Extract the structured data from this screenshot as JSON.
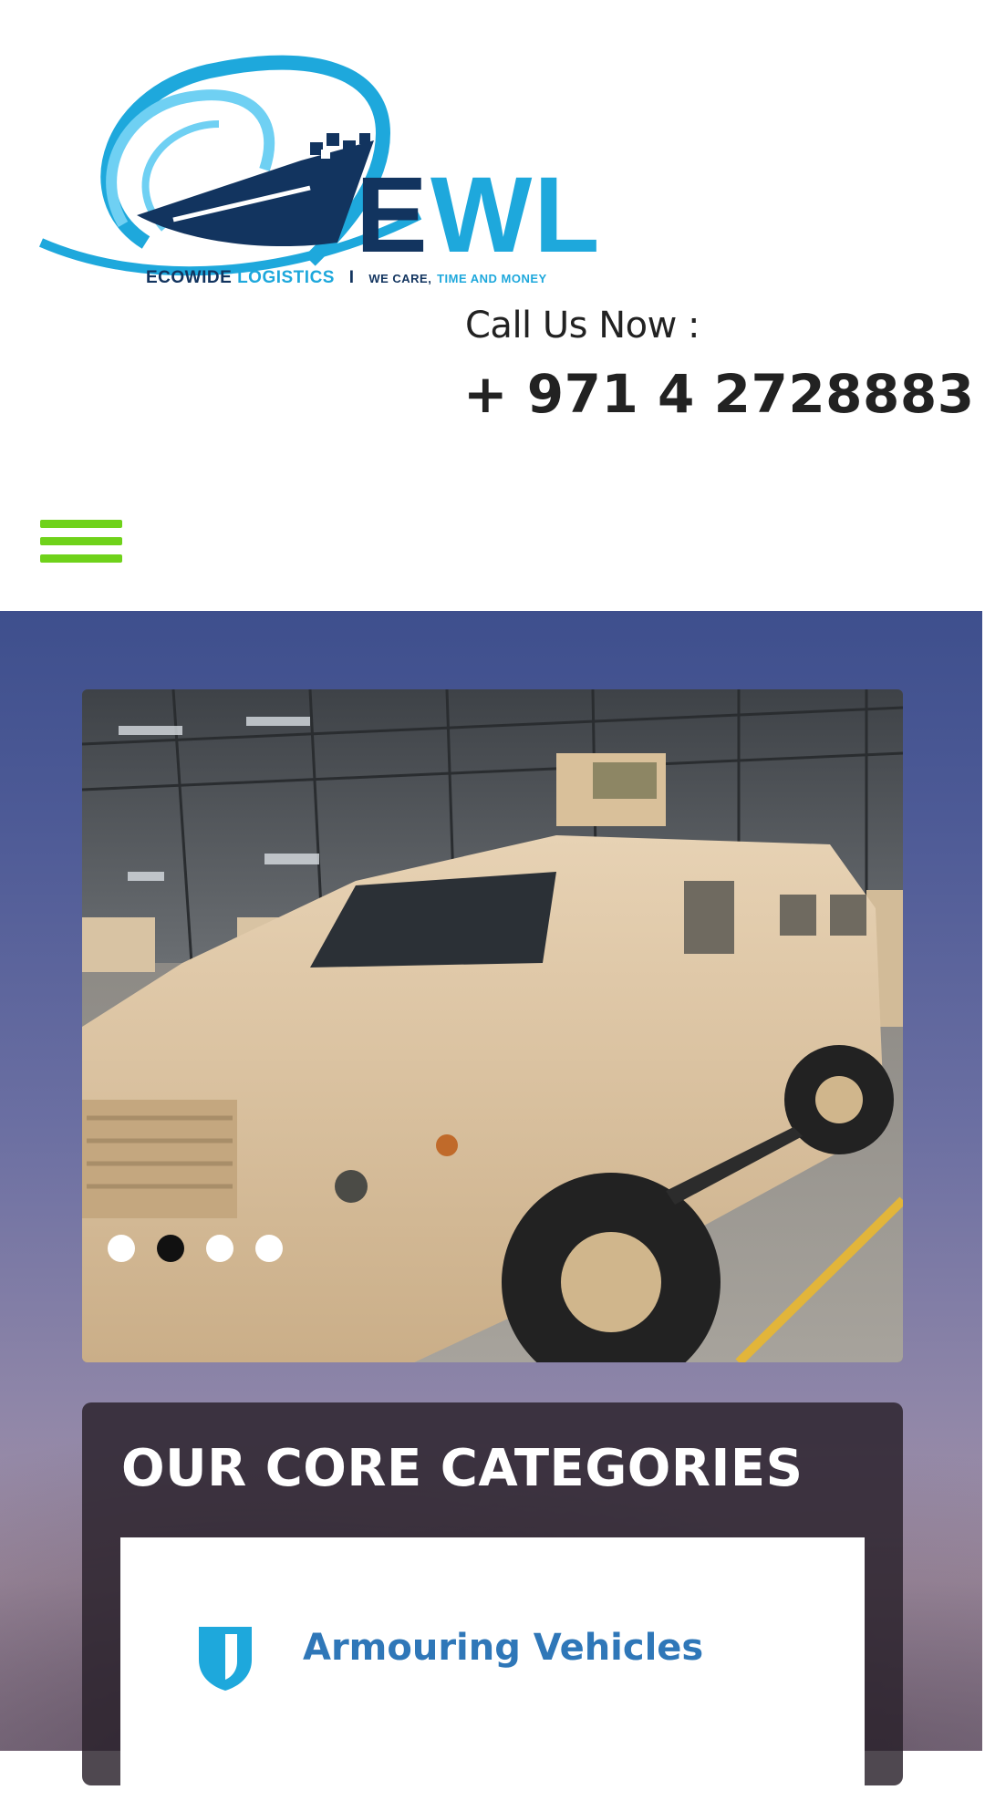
{
  "header": {
    "logo": {
      "wordmark": "EWL",
      "company_part1": "ECOWIDE",
      "company_part2": "LOGISTICS",
      "separator": "I",
      "tagline_part1": "WE CARE,",
      "tagline_part2": "TIME AND MONEY",
      "colors": {
        "navy": "#12345f",
        "sky": "#1ea8dc",
        "light_sky": "#6fd0f3"
      }
    },
    "call_label": "Call Us Now :",
    "phone": "+ 971 4 2728883",
    "menu_icon": "hamburger-icon",
    "menu_color": "#6fd21a"
  },
  "slider": {
    "image": "armoured-vehicle-photo",
    "slide_count": 4,
    "active_index": 1
  },
  "categories": {
    "title": "OUR CORE CATEGORIES",
    "items": [
      {
        "label": "Armouring Vehicles",
        "icon": "shield-icon",
        "color": "#2f77b8"
      }
    ]
  }
}
